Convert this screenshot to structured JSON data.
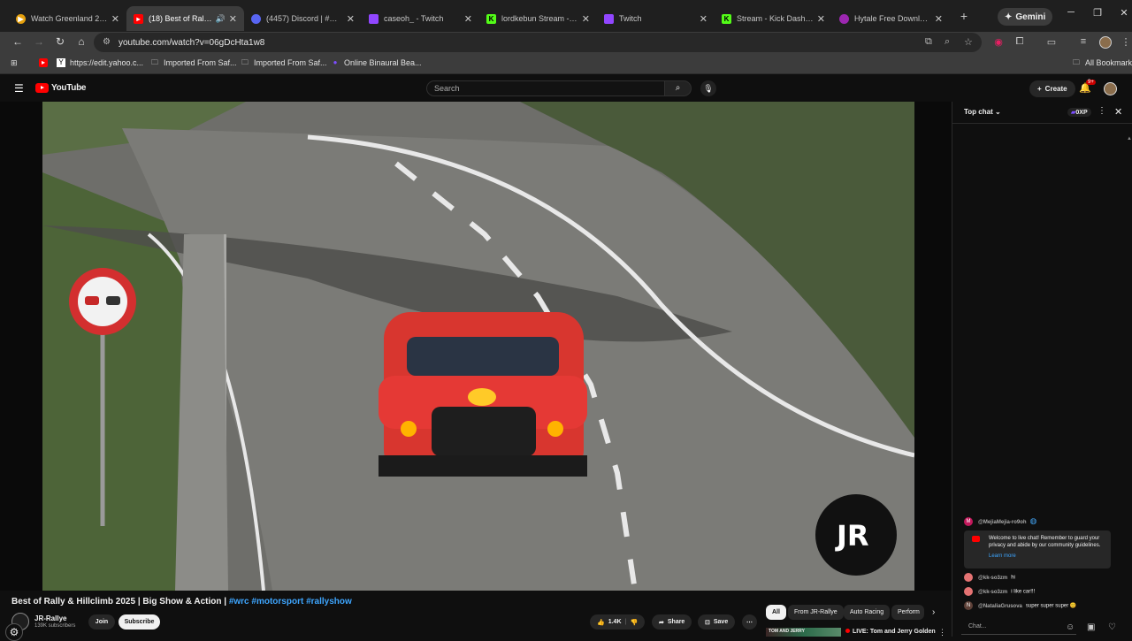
{
  "tabs": [
    {
      "title": "Watch Greenland 2: Mig",
      "icon": "plex-icon",
      "color": "#e5a00d",
      "active": false
    },
    {
      "title": "(18) Best of Rally & H",
      "icon": "youtube-icon",
      "color": "#ff0000",
      "active": true,
      "audio": true
    },
    {
      "title": "(4457) Discord | #📺💬",
      "icon": "discord-icon",
      "color": "#5865f2",
      "active": false
    },
    {
      "title": "caseoh_ - Twitch",
      "icon": "twitch-icon",
      "color": "#9146ff",
      "active": false
    },
    {
      "title": "lordkebun Stream - Wa",
      "icon": "kick-icon",
      "color": "#53fc18",
      "active": false
    },
    {
      "title": "Twitch",
      "icon": "twitch-icon",
      "color": "#9146ff",
      "active": false
    },
    {
      "title": "Stream - Kick Dashboa",
      "icon": "kick-icon",
      "color": "#53fc18",
      "active": false
    },
    {
      "title": "Hytale Free Download",
      "icon": "hytale-icon",
      "color": "#9c27b0",
      "active": false
    }
  ],
  "gemini_label": "Gemini",
  "address": {
    "url": "youtube.com/watch?v=06gDcHta1w8"
  },
  "bookmarks": [
    {
      "label": "",
      "icon": "youtube-icon"
    },
    {
      "label": "https://edit.yahoo.c...",
      "icon": "yahoo-icon"
    },
    {
      "label": "Imported From Saf...",
      "icon": "folder-icon"
    },
    {
      "label": "Imported From Saf...",
      "icon": "folder-icon"
    },
    {
      "label": "Online Binaural Bea...",
      "icon": "binaural-icon"
    }
  ],
  "all_bookmarks": "All Bookmarks",
  "youtube": {
    "logo_text": "YouTube",
    "search_placeholder": "Search",
    "create_label": "Create",
    "notification_count": "9+"
  },
  "video": {
    "title_main": "Best of Rally & Hillclimb 2025 | Big Show & Action | ",
    "hashtags": "#wrc #motorsport #rallyshow",
    "channel": "JR-Rallye",
    "subscribers": "139K subscribers",
    "join": "Join",
    "subscribe": "Subscribe",
    "likes": "1.4K",
    "share": "Share",
    "save": "Save",
    "watermark": "JR"
  },
  "chips": [
    "All",
    "From JR-Rallye",
    "Auto Racing",
    "Perform"
  ],
  "next_video": {
    "thumb_text": "TOM AND JERRY",
    "live_title": "LIVE: Tom and Jerry Golden"
  },
  "chat": {
    "mode": "Top chat",
    "xp": "0XP",
    "messages": [
      {
        "author": "@MejiaMejia-ro9oh",
        "text": "",
        "avatar_color": "#c2185b",
        "initial": "M"
      },
      {
        "author": "@kk-so3zm",
        "text": "hi",
        "avatar_color": "#e57373",
        "initial": ""
      },
      {
        "author": "@kk-so3zm",
        "text": "i like car!!!",
        "avatar_color": "#e57373",
        "initial": ""
      },
      {
        "author": "@NataliaGrusova",
        "text": "super super super 😊",
        "avatar_color": "#5d4037",
        "initial": "N"
      }
    ],
    "welcome_text": "Welcome to live chat! Remember to guard your privacy and abide by our community guidelines.",
    "learn_more": "Learn more",
    "input_placeholder": "Chat..."
  }
}
